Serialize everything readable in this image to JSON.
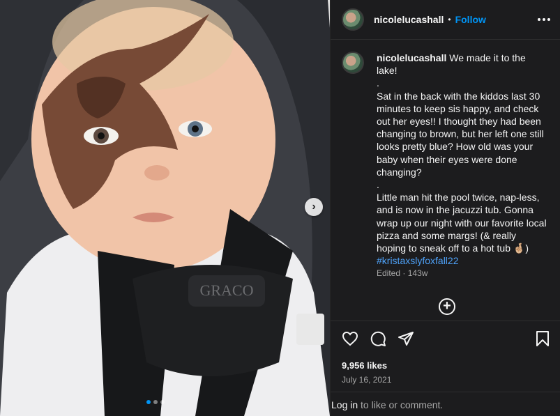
{
  "post": {
    "username": "nicolelucashall",
    "separator": "•",
    "follow_label": "Follow",
    "caption_lines": [
      "We made it to the lake!",
      ".",
      "Sat in the back with the kiddos last 30 minutes to keep sis happy, and check out her eyes!! I thought they had been changing to brown, but her left one still looks pretty blue? How old was your baby when their eyes were done changing?",
      ".",
      "Little man hit the pool twice, nap-less, and is now in the jacuzzi tub. Gonna wrap up our night with our favorite local pizza and some margs! (& really hoping to sneak off to a hot tub 🤞🏼)"
    ],
    "hashtag": "#kristaxslyfoxfall22",
    "edited_label": "Edited",
    "meta_sep": "·",
    "age": "143w",
    "likes": "9,956 likes",
    "date": "July 16, 2021",
    "login_link": "Log in",
    "login_suffix": " to like or comment."
  },
  "carousel": {
    "slides": 3,
    "active": 0
  },
  "icons": {
    "more": "more-horizontal-icon",
    "next": "chevron-right-icon",
    "load_more": "plus-circle-icon",
    "like": "heart-icon",
    "comment": "comment-bubble-icon",
    "share": "paper-plane-icon",
    "save": "bookmark-icon"
  },
  "colors": {
    "accent": "#0095f6",
    "panel_bg": "#1c1c1e",
    "muted": "#a8a8a8"
  }
}
